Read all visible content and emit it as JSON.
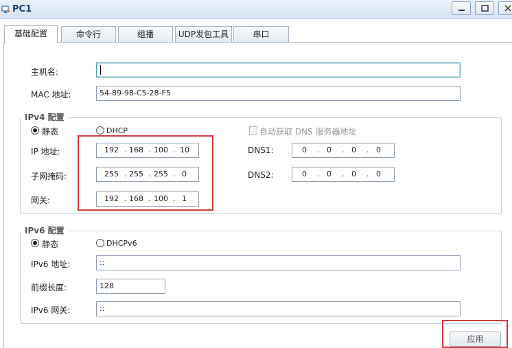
{
  "window": {
    "title": "PC1"
  },
  "tabs": [
    {
      "label": "基础配置"
    },
    {
      "label": "命令行"
    },
    {
      "label": "组播"
    },
    {
      "label": "UDP发包工具"
    },
    {
      "label": "串口"
    }
  ],
  "basic": {
    "hostname_label": "主机名:",
    "hostname_value": "",
    "mac_label": "MAC 地址:",
    "mac_value": "54-89-98-C5-28-F5"
  },
  "ipv4": {
    "group_title": "IPv4 配置",
    "static_label": "静态",
    "dhcp_label": "DHCP",
    "mode": "static",
    "auto_dns_label": "自动获取 DNS 服务器地址",
    "ip_label": "IP 地址:",
    "ip": [
      "192",
      "168",
      "100",
      "10"
    ],
    "mask_label": "子网掩码:",
    "mask": [
      "255",
      "255",
      "255",
      "0"
    ],
    "gateway_label": "网关:",
    "gateway": [
      "192",
      "168",
      "100",
      "1"
    ],
    "dns1_label": "DNS1:",
    "dns1": [
      "0",
      "0",
      "0",
      "0"
    ],
    "dns2_label": "DNS2:",
    "dns2": [
      "0",
      "0",
      "0",
      "0"
    ]
  },
  "ipv6": {
    "group_title": "IPv6 配置",
    "static_label": "静态",
    "dhcp_label": "DHCPv6",
    "mode": "static",
    "address_label": "IPv6 地址:",
    "address_value": "::",
    "prefix_label": "前缀长度:",
    "prefix_value": "128",
    "gateway_label": "IPv6 网关:",
    "gateway_value": "::"
  },
  "apply_label": "应用",
  "colors": {
    "highlight": "#d33a3a",
    "titlebar": "#dbe6f4",
    "title_text": "#1d3f73"
  }
}
